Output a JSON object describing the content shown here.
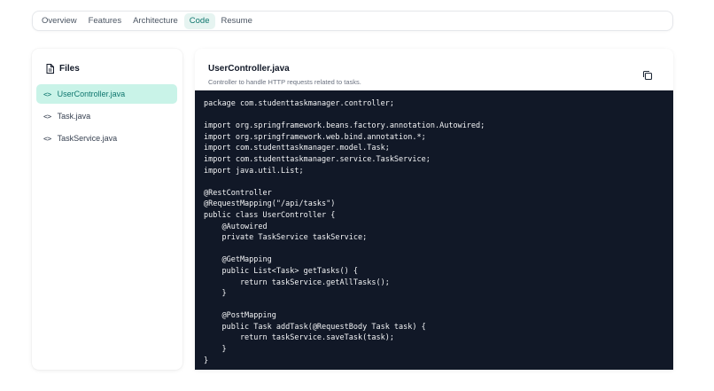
{
  "tabs": [
    {
      "label": "Overview"
    },
    {
      "label": "Features"
    },
    {
      "label": "Architecture"
    },
    {
      "label": "Code"
    },
    {
      "label": "Resume"
    }
  ],
  "active_tab": "Code",
  "files": {
    "title": "Files",
    "items": [
      {
        "label": "UserController.java",
        "active": true
      },
      {
        "label": "Task.java",
        "active": false
      },
      {
        "label": "TaskService.java",
        "active": false
      }
    ]
  },
  "code_view": {
    "filename": "UserController.java",
    "description": "Controller to handle HTTP requests related to tasks.",
    "code": "package com.studenttaskmanager.controller;\n\nimport org.springframework.beans.factory.annotation.Autowired;\nimport org.springframework.web.bind.annotation.*;\nimport com.studenttaskmanager.model.Task;\nimport com.studenttaskmanager.service.TaskService;\nimport java.util.List;\n\n@RestController\n@RequestMapping(\"/api/tasks\")\npublic class UserController {\n    @Autowired\n    private TaskService taskService;\n\n    @GetMapping\n    public List<Task> getTasks() {\n        return taskService.getAllTasks();\n    }\n\n    @PostMapping\n    public Task addTask(@RequestBody Task task) {\n        return taskService.saveTask(task);\n    }\n}"
  },
  "icons": {
    "files": "file-icon",
    "file_item": "code-icon",
    "copy": "copy-icon"
  },
  "colors": {
    "accent": "#0f766e",
    "active_file_bg": "#c9f3e8",
    "active_tab_bg": "#e6f4f1",
    "code_bg": "#111827"
  }
}
